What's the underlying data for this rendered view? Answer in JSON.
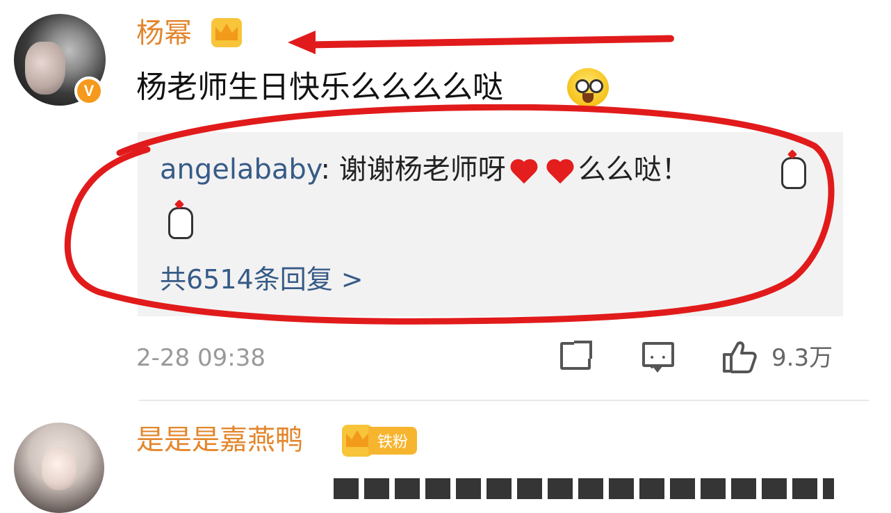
{
  "comment1": {
    "username": "杨幂",
    "verified_badge": "V",
    "text": "杨老师生日快乐么么么么哒",
    "emoji": "grinning-face-emoji",
    "reply": {
      "author": "angelababy",
      "separator": ": ",
      "text_before_hearts": "谢谢杨老师呀",
      "text_after_hearts": "么么哒！",
      "hearts": 2,
      "hand_icons": 2
    },
    "reply_count_label": "共6514条回复 >",
    "timestamp": "2-28 09:38",
    "like_count": "9.3万"
  },
  "comment2": {
    "username": "是是是嘉燕鸭",
    "fan_badge": "铁粉",
    "crown_level": "3"
  },
  "colors": {
    "username": "#e3862d",
    "link_blue": "#375b87",
    "annotation_red": "#e11b1b",
    "reply_bg": "#f2f2f2"
  }
}
